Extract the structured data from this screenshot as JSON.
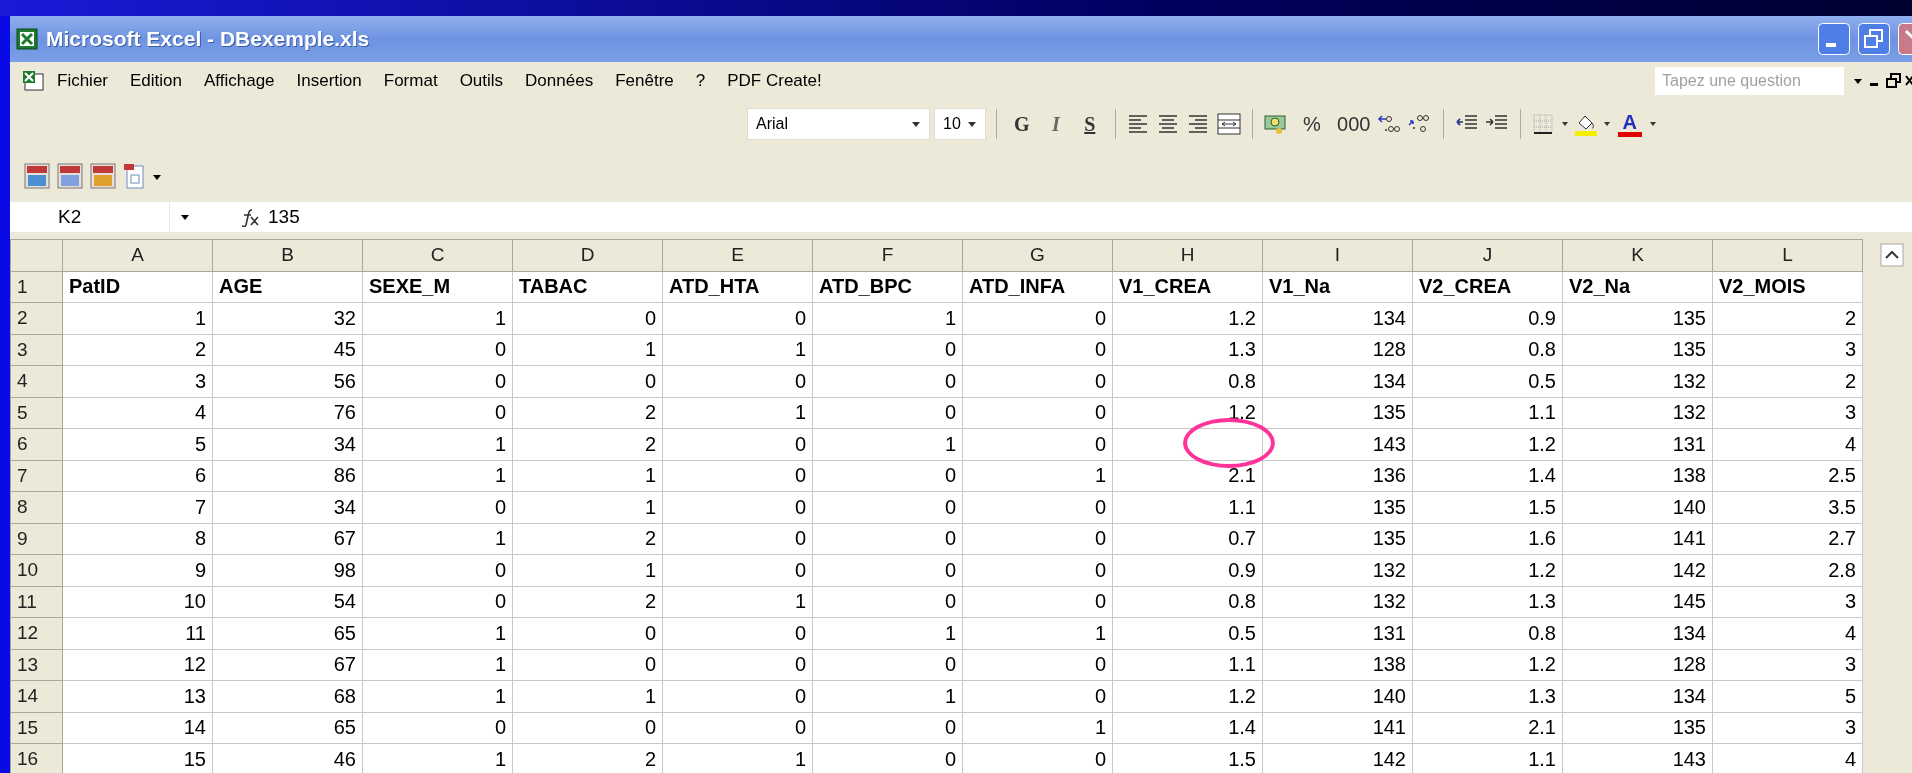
{
  "window": {
    "title": "Microsoft Excel - DBexemple.xls"
  },
  "menu": [
    {
      "label": "Fichier"
    },
    {
      "label": "Edition"
    },
    {
      "label": "Affichage"
    },
    {
      "label": "Insertion"
    },
    {
      "label": "Format"
    },
    {
      "label": "Outils"
    },
    {
      "label": "Données"
    },
    {
      "label": "Fenêtre"
    },
    {
      "label": "?"
    },
    {
      "label": "PDF Create!"
    }
  ],
  "help_box": {
    "placeholder": "Tapez une question"
  },
  "format_toolbar": {
    "font": "Arial",
    "size": "10",
    "buttons": [
      {
        "kind": "bold",
        "label": "G"
      },
      {
        "kind": "italic",
        "label": "I"
      },
      {
        "kind": "underline",
        "label": "S"
      },
      {
        "kind": "align-left"
      },
      {
        "kind": "align-center"
      },
      {
        "kind": "align-right"
      },
      {
        "kind": "merge"
      },
      {
        "kind": "currency"
      },
      {
        "kind": "text",
        "label": "%"
      },
      {
        "kind": "text",
        "label": "000"
      },
      {
        "kind": "inc-decimal"
      },
      {
        "kind": "dec-decimal"
      },
      {
        "kind": "outdent"
      },
      {
        "kind": "indent"
      },
      {
        "kind": "borders"
      },
      {
        "kind": "fill"
      },
      {
        "kind": "font-color",
        "label": "A"
      }
    ]
  },
  "formula_bar": {
    "name_box": "K2",
    "value": "135"
  },
  "sheet": {
    "columns": [
      "A",
      "B",
      "C",
      "D",
      "E",
      "F",
      "G",
      "H",
      "I",
      "J",
      "K",
      "L"
    ],
    "rows": [
      {
        "header": "1",
        "cells": [
          "PatID",
          "AGE",
          "SEXE_M",
          "TABAC",
          "ATD_HTA",
          "ATD_BPC",
          "ATD_INFA",
          "V1_CREA",
          "V1_Na",
          "V2_CREA",
          "V2_Na",
          "V2_MOIS"
        ]
      },
      {
        "header": "2",
        "cells": [
          "1",
          "32",
          "1",
          "0",
          "0",
          "1",
          "0",
          "1.2",
          "134",
          "0.9",
          "135",
          "2"
        ]
      },
      {
        "header": "3",
        "cells": [
          "2",
          "45",
          "0",
          "1",
          "1",
          "0",
          "0",
          "1.3",
          "128",
          "0.8",
          "135",
          "3"
        ]
      },
      {
        "header": "4",
        "cells": [
          "3",
          "56",
          "0",
          "0",
          "0",
          "0",
          "0",
          "0.8",
          "134",
          "0.5",
          "132",
          "2"
        ]
      },
      {
        "header": "5",
        "cells": [
          "4",
          "76",
          "0",
          "2",
          "1",
          "0",
          "0",
          "1.2",
          "135",
          "1.1",
          "132",
          "3"
        ]
      },
      {
        "header": "6",
        "cells": [
          "5",
          "34",
          "1",
          "2",
          "0",
          "1",
          "0",
          {
            "circled": true
          },
          "143",
          "1.2",
          "131",
          "4"
        ]
      },
      {
        "header": "7",
        "cells": [
          "6",
          "86",
          "1",
          "1",
          "0",
          "0",
          "1",
          "2.1",
          "136",
          "1.4",
          "138",
          "2.5"
        ]
      },
      {
        "header": "8",
        "cells": [
          "7",
          "34",
          "0",
          "1",
          "0",
          "0",
          "0",
          "1.1",
          "135",
          "1.5",
          "140",
          "3.5"
        ]
      },
      {
        "header": "9",
        "cells": [
          "8",
          "67",
          "1",
          "2",
          "0",
          "0",
          "0",
          "0.7",
          "135",
          "1.6",
          "141",
          "2.7"
        ]
      },
      {
        "header": "10",
        "cells": [
          "9",
          "98",
          "0",
          "1",
          "0",
          "0",
          "0",
          "0.9",
          "132",
          "1.2",
          "142",
          "2.8"
        ]
      },
      {
        "header": "11",
        "cells": [
          "10",
          "54",
          "0",
          "2",
          "1",
          "0",
          "0",
          "0.8",
          "132",
          "1.3",
          "145",
          "3"
        ]
      },
      {
        "header": "12",
        "cells": [
          "11",
          "65",
          "1",
          "0",
          "0",
          "1",
          "1",
          "0.5",
          "131",
          "0.8",
          "134",
          "4"
        ]
      },
      {
        "header": "13",
        "cells": [
          "12",
          "67",
          "1",
          "0",
          "0",
          "0",
          "0",
          "1.1",
          "138",
          "1.2",
          "128",
          "3"
        ]
      },
      {
        "header": "14",
        "cells": [
          "13",
          "68",
          "1",
          "1",
          "0",
          "1",
          "0",
          "1.2",
          "140",
          "1.3",
          "134",
          "5"
        ]
      },
      {
        "header": "15",
        "cells": [
          "14",
          "65",
          "0",
          "0",
          "0",
          "0",
          "1",
          "1.4",
          "141",
          "2.1",
          "135",
          "3"
        ]
      },
      {
        "header": "16",
        "cells": [
          "15",
          "46",
          "1",
          "2",
          "1",
          "0",
          "0",
          "1.5",
          "142",
          "1.1",
          "143",
          "4"
        ]
      }
    ]
  }
}
